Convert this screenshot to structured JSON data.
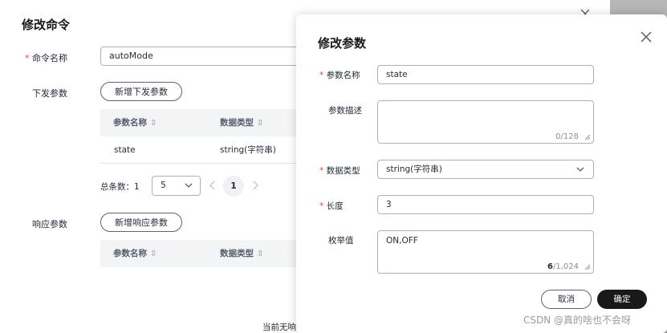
{
  "background_dialog": {
    "title": "修改命令",
    "name_label": "命令名称",
    "name_value": "autoMode",
    "down_params_label": "下发参数",
    "add_down_param": "新增下发参数",
    "table_headers": [
      "参数名称",
      "数据类型"
    ],
    "down_rows": [
      {
        "name": "state",
        "type": "string(字符串)"
      }
    ],
    "pager": {
      "total_label": "总条数：1",
      "page_size": "5",
      "current_page": "1"
    },
    "resp_params_label": "响应参数",
    "add_resp_param": "新增响应参数",
    "empty_text": "当前无响应"
  },
  "param_dialog": {
    "title": "修改参数",
    "fields": {
      "name_label": "参数名称",
      "name_value": "state",
      "desc_label": "参数描述",
      "desc_counter": "0/128",
      "type_label": "数据类型",
      "type_value": "string(字符串)",
      "length_label": "长度",
      "length_value": "3",
      "enum_label": "枚举值",
      "enum_value": "ON,OFF",
      "enum_counter_current": "6",
      "enum_counter_max": "/1,024"
    },
    "cancel_label": "取消",
    "ok_label": "确定"
  },
  "icons": {
    "close": "close-icon",
    "chevron": "chevron-down-icon",
    "sort": "sort-icon",
    "prev": "chevron-left-icon",
    "next": "chevron-right-icon"
  },
  "colors": {
    "required": "#e54545",
    "primary_button": "#191919",
    "side_strip": "#9a9a9a"
  },
  "watermark": "CSDN @真的啥也不会呀"
}
